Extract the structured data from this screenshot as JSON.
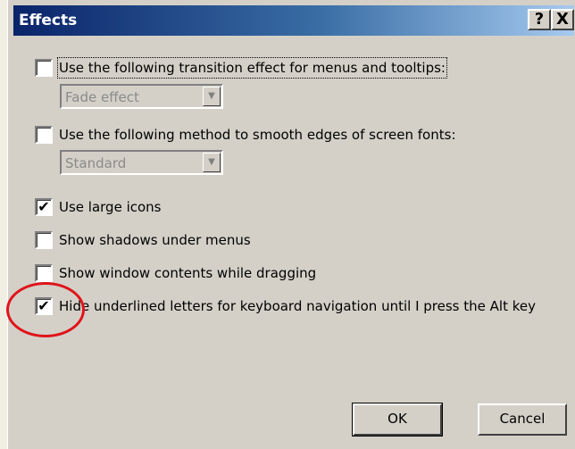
{
  "dialog": {
    "title": "Effects",
    "help_button": "?",
    "close_button": "X"
  },
  "options": [
    {
      "label": "Use the following transition effect for menus and tooltips:",
      "checked": false
    },
    {
      "label": "Use the following method to smooth edges of screen fonts:",
      "checked": false
    },
    {
      "label": "Use large icons",
      "checked": true
    },
    {
      "label": "Show shadows under menus",
      "checked": false
    },
    {
      "label": "Show window contents while dragging",
      "checked": false
    },
    {
      "label": "Hide underlined letters for keyboard navigation until I press the Alt key",
      "checked": true
    }
  ],
  "transition_select": {
    "value": "Fade effect"
  },
  "font_smoothing_select": {
    "value": "Standard"
  },
  "buttons": {
    "ok": "OK",
    "cancel": "Cancel"
  },
  "check_mark": "✔",
  "annotation": {
    "color": "#e0141a"
  }
}
